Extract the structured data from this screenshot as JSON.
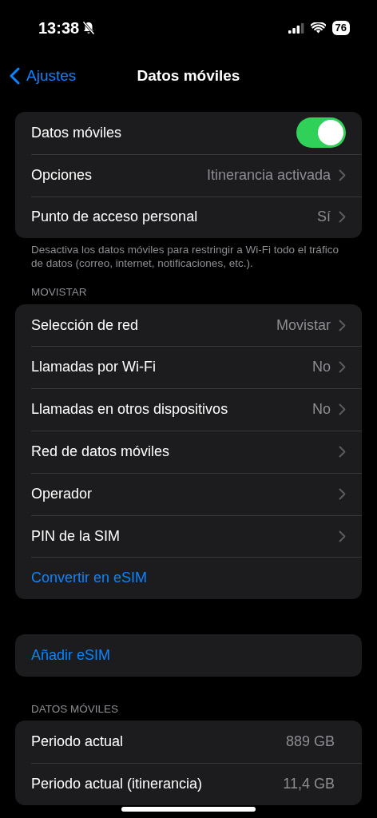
{
  "status_bar": {
    "time": "13:38",
    "silenced": true,
    "battery": "76"
  },
  "nav": {
    "back": "Ajustes",
    "title": "Datos móviles"
  },
  "sections": [
    {
      "rows": [
        {
          "kind": "toggle",
          "label": "Datos móviles",
          "on": true
        },
        {
          "kind": "detail",
          "label": "Opciones",
          "value": "Itinerancia activada"
        },
        {
          "kind": "detail",
          "label": "Punto de acceso personal",
          "value": "Sí"
        }
      ],
      "footer": "Desactiva los datos móviles para restringir a Wi-Fi todo el tráfico de datos (correo, internet, notificaciones, etc.)."
    },
    {
      "header": "MOVISTAR",
      "rows": [
        {
          "kind": "detail",
          "label": "Selección de red",
          "value": "Movistar"
        },
        {
          "kind": "detail",
          "label": "Llamadas por Wi-Fi",
          "value": "No"
        },
        {
          "kind": "detail",
          "label": "Llamadas en otros dispositivos",
          "value": "No"
        },
        {
          "kind": "detail",
          "label": "Red de datos móviles"
        },
        {
          "kind": "detail",
          "label": "Operador"
        },
        {
          "kind": "detail",
          "label": "PIN de la SIM"
        },
        {
          "kind": "action",
          "label": "Convertir en eSIM"
        }
      ]
    },
    {
      "rows": [
        {
          "kind": "action",
          "label": "Añadir eSIM"
        }
      ]
    },
    {
      "header": "DATOS MÓVILES",
      "rows": [
        {
          "kind": "value",
          "label": "Periodo actual",
          "value": "889 GB"
        },
        {
          "kind": "value",
          "label": "Periodo actual (itinerancia)",
          "value": "11,4 GB"
        }
      ]
    }
  ]
}
